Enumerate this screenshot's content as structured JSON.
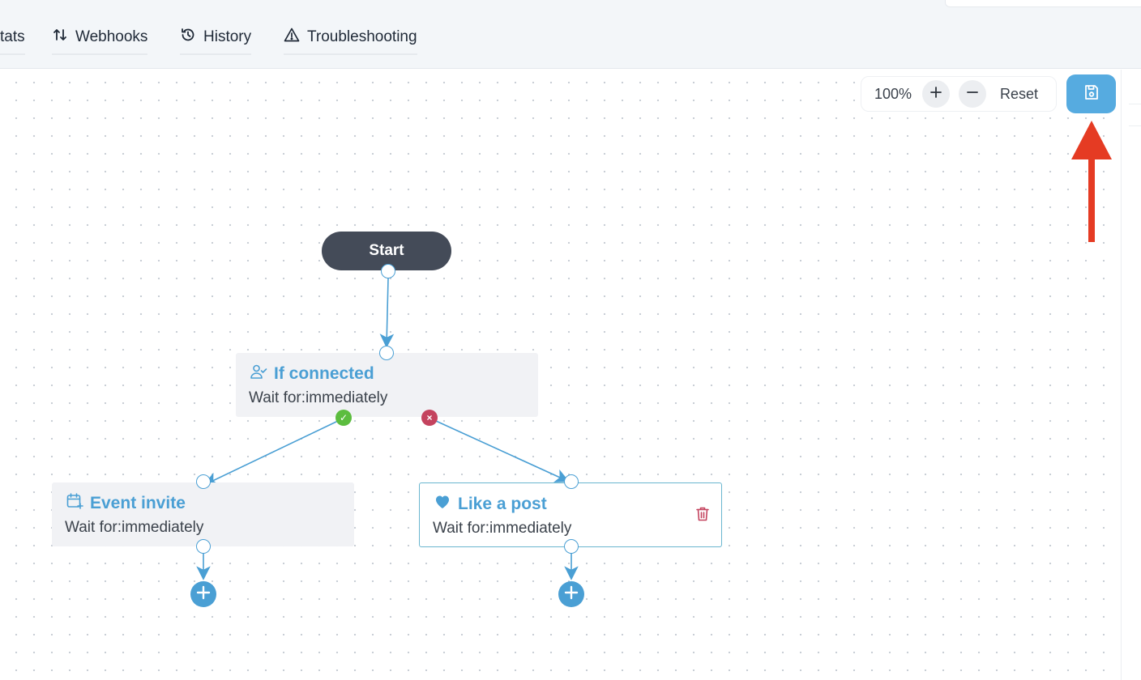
{
  "tabs": [
    {
      "label": "tats",
      "icon": "none"
    },
    {
      "label": "Webhooks",
      "icon": "webhooks-arrows-icon"
    },
    {
      "label": "History",
      "icon": "history-icon"
    },
    {
      "label": "Troubleshooting",
      "icon": "warning-triangle-icon"
    }
  ],
  "zoom": {
    "level": "100%",
    "reset_label": "Reset"
  },
  "save": {
    "icon": "save-icon"
  },
  "flow": {
    "start_label": "Start",
    "nodes": [
      {
        "title": "If connected",
        "subtitle": "Wait for:immediately",
        "icon": "user-check-icon"
      },
      {
        "title": "Event invite",
        "subtitle": "Wait for:immediately",
        "icon": "calendar-plus-icon"
      },
      {
        "title": "Like a post",
        "subtitle": "Wait for:immediately",
        "icon": "heart-icon"
      }
    ],
    "yes_badge": "✓",
    "no_badge": "×"
  },
  "colors": {
    "accent": "#4a9fd4",
    "save_button": "#56abe0",
    "start_node": "#444b58",
    "yes": "#5cbd3f",
    "no": "#c4435e",
    "annotation_arrow": "#e53b23"
  }
}
